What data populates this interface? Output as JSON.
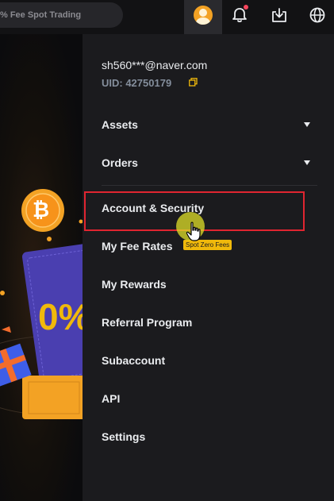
{
  "topbar": {
    "search_text": "% Fee Spot Trading"
  },
  "user": {
    "email": "sh560***@naver.com",
    "uid": "UID: 42750179"
  },
  "menu": {
    "assets": "Assets",
    "orders": "Orders",
    "account_security": "Account & Security",
    "fee_rates": "My Fee Rates",
    "fee_badge": "Spot Zero Fees",
    "rewards": "My Rewards",
    "referral": "Referral Program",
    "subaccount": "Subaccount",
    "api": "API",
    "settings": "Settings"
  },
  "promo": {
    "percent_text": "0%",
    "coin_symbol": "₿"
  },
  "colors": {
    "accent": "#f0b90b",
    "highlight": "#e02530",
    "notification": "#f6465d"
  }
}
